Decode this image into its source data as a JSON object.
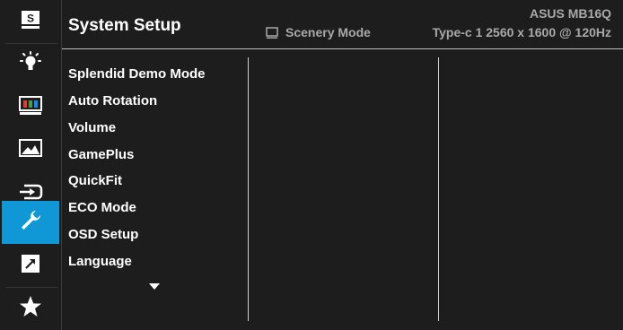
{
  "header": {
    "title": "System Setup",
    "model": "ASUS MB16Q",
    "mode": "Scenery Mode",
    "signal": "Type-c 1  2560 x 1600 @ 120Hz"
  },
  "sidebar": {
    "items": [
      {
        "icon": "splendid-icon",
        "active": false
      },
      {
        "icon": "blue-light-filter-icon",
        "active": false
      },
      {
        "icon": "color-icon",
        "active": false
      },
      {
        "icon": "image-icon",
        "active": false
      },
      {
        "icon": "input-select-icon",
        "active": false
      },
      {
        "icon": "wrench-icon",
        "active": true
      },
      {
        "icon": "shortcut-icon",
        "active": false
      },
      {
        "icon": "star-icon",
        "active": false
      }
    ],
    "splendid_letter": "S"
  },
  "menu": {
    "items": [
      {
        "label": "Splendid Demo Mode"
      },
      {
        "label": "Auto Rotation"
      },
      {
        "label": "Volume"
      },
      {
        "label": "GamePlus"
      },
      {
        "label": "QuickFit"
      },
      {
        "label": "ECO Mode"
      },
      {
        "label": "OSD Setup"
      },
      {
        "label": "Language"
      }
    ]
  },
  "colors": {
    "accent": "#1098d6",
    "background": "#1d1d1d",
    "secondary_text": "#a9a9a9"
  }
}
